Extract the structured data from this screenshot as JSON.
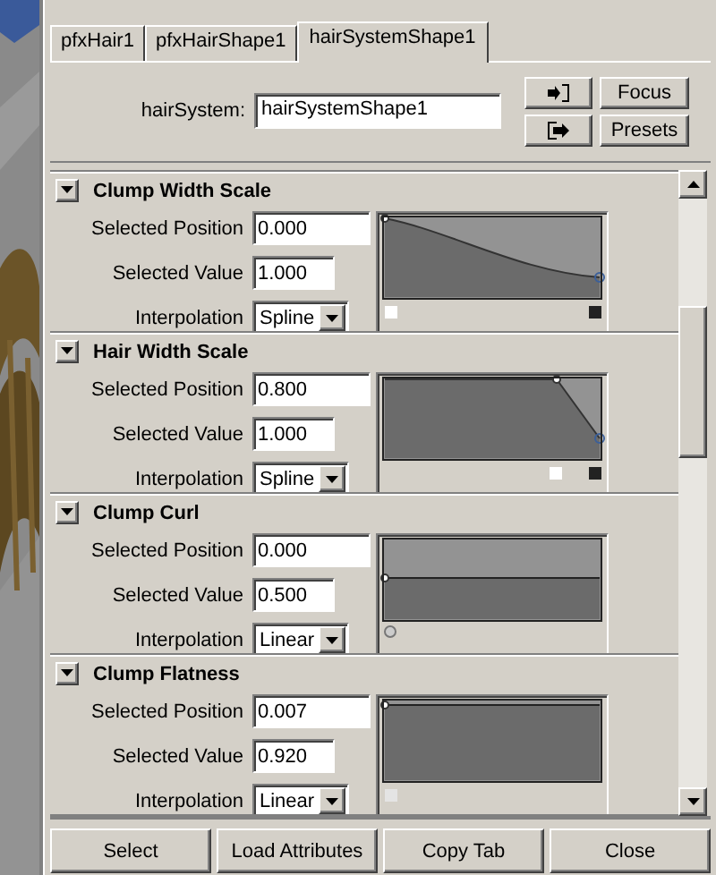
{
  "tabs": [
    {
      "label": "pfxHair1",
      "selected": false
    },
    {
      "label": "pfxHairShape1",
      "selected": false
    },
    {
      "label": "hairSystemShape1",
      "selected": true
    }
  ],
  "node": {
    "label": "hairSystem:",
    "value": "hairSystemShape1"
  },
  "side_buttons": [
    "Focus",
    "Presets"
  ],
  "sections": [
    {
      "title": "Clump Width Scale",
      "expanded": true,
      "kind": "falling",
      "fields": [
        {
          "kind": "text",
          "label": "Selected Position",
          "value": "0.000"
        },
        {
          "kind": "text",
          "label": "Selected Value",
          "value": "1.000"
        },
        {
          "kind": "dropdown",
          "label": "Interpolation",
          "value": "Spline"
        }
      ]
    },
    {
      "title": "Hair Width Scale",
      "expanded": true,
      "kind": "knee",
      "fields": [
        {
          "kind": "text",
          "label": "Selected Position",
          "value": "0.800"
        },
        {
          "kind": "text",
          "label": "Selected Value",
          "value": "1.000"
        },
        {
          "kind": "dropdown",
          "label": "Interpolation",
          "value": "Spline"
        }
      ]
    },
    {
      "title": "Clump Curl",
      "expanded": true,
      "kind": "flat",
      "fields": [
        {
          "kind": "text",
          "label": "Selected Position",
          "value": "0.000"
        },
        {
          "kind": "text",
          "label": "Selected Value",
          "value": "0.500"
        },
        {
          "kind": "dropdown",
          "label": "Interpolation",
          "value": "Linear"
        }
      ]
    },
    {
      "title": "Clump Flatness",
      "expanded": true,
      "kind": "top",
      "fields": [
        {
          "kind": "text",
          "label": "Selected Position",
          "value": "0.007"
        },
        {
          "kind": "text",
          "label": "Selected Value",
          "value": "0.920"
        },
        {
          "kind": "dropdown",
          "label": "Interpolation",
          "value": "Linear"
        }
      ]
    }
  ],
  "buttons": [
    "Select",
    "Load Attributes",
    "Copy Tab",
    "Close"
  ]
}
